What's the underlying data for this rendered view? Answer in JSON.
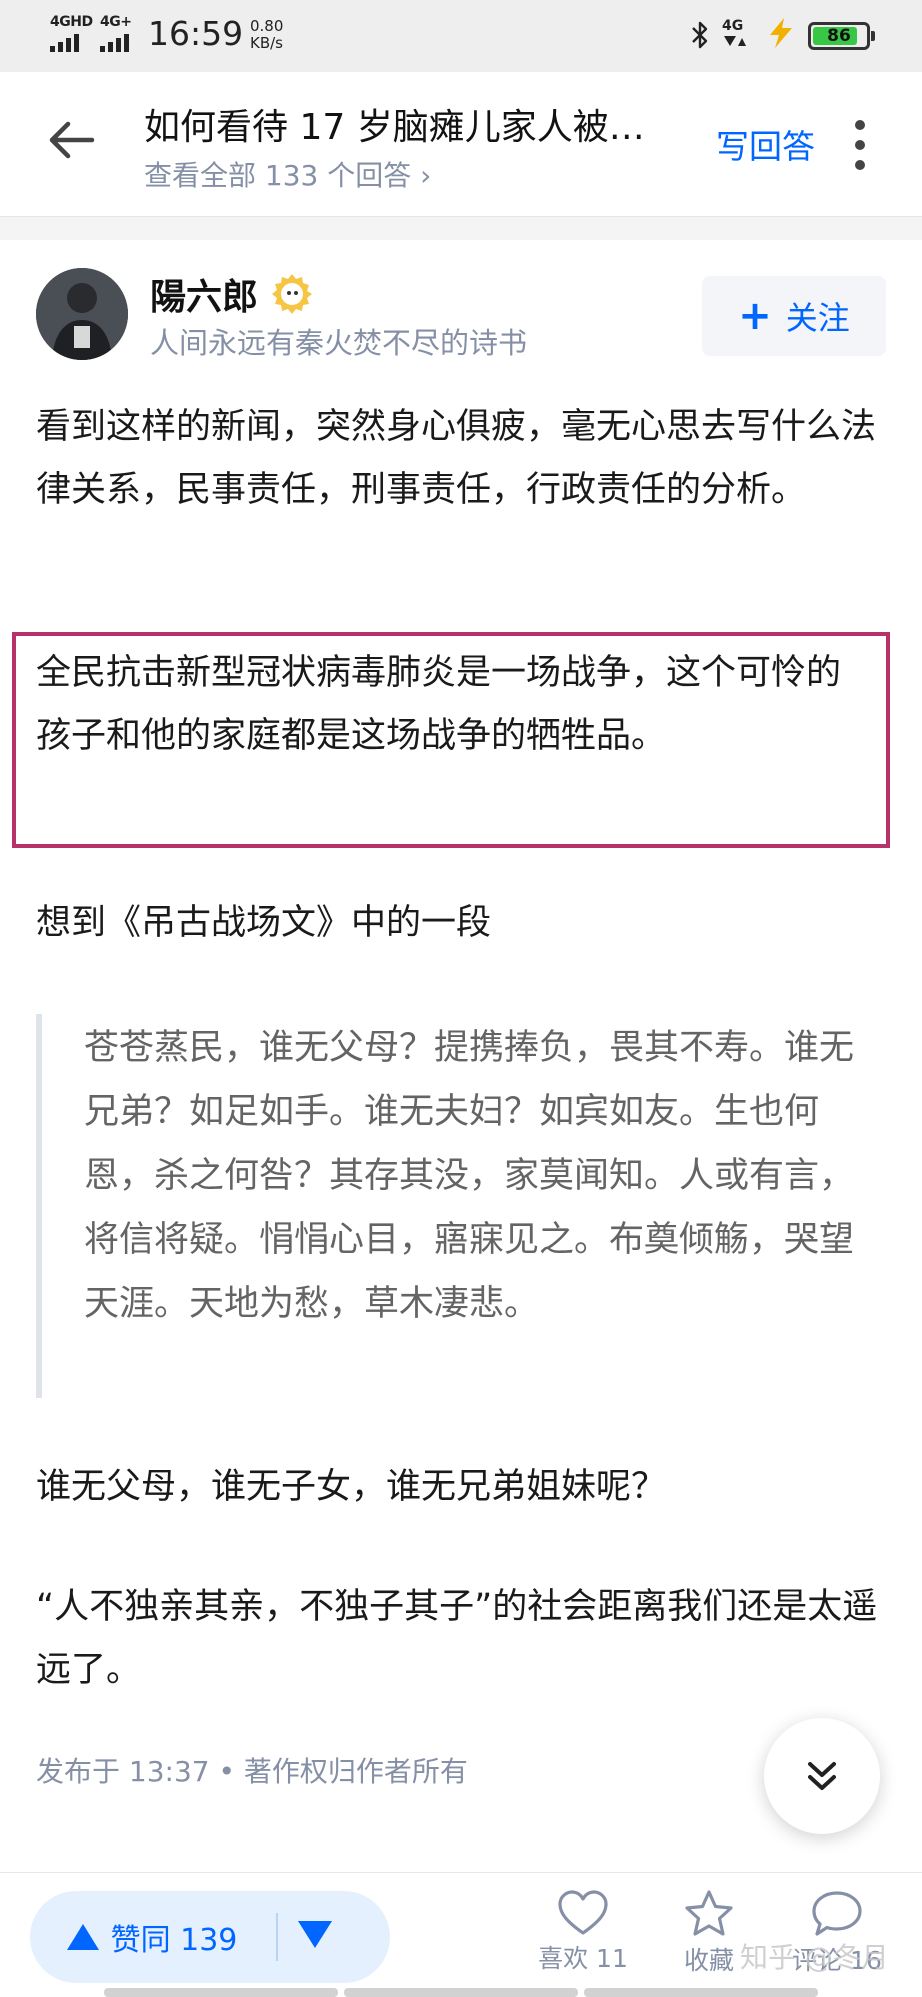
{
  "status_bar": {
    "signal1_label": "4GHD",
    "signal2_label": "4G+",
    "time": "16:59",
    "net_speed_value": "0.80",
    "net_speed_unit": "KB/s",
    "signal3_label": "4G",
    "battery_percent": "86",
    "battery_level": 0.86
  },
  "header": {
    "title": "如何看待 17 岁脑瘫儿家人被…",
    "subtitle": "查看全部 133 个回答 ›",
    "write_answer": "写回答"
  },
  "author": {
    "name": "陽六郎",
    "motto": "人间永远有秦火焚不尽的诗书",
    "follow_label": "关注"
  },
  "content": {
    "p1": "看到这样的新闻，突然身心俱疲，毫无心思去写什么法律关系，民事责任，刑事责任，行政责任的分析。",
    "p2": "全民抗击新型冠状病毒肺炎是一场战争，这个可怜的孩子和他的家庭都是这场战争的牺牲品。",
    "p3": "想到《吊古战场文》中的一段",
    "quote": "苍苍蒸民，谁无父母？提携捧负，畏其不寿。谁无兄弟？如足如手。谁无夫妇？如宾如友。生也何恩，杀之何咎？其存其没，家莫闻知。人或有言，将信将疑。悁悁心目，寤寐见之。布奠倾觞，哭望天涯。天地为愁，草木凄悲。",
    "p4": "谁无父母，谁无子女，谁无兄弟姐妹呢？",
    "p5": "“人不独亲其亲，不独子其子”的社会距离我们还是太遥远了。",
    "publish": "发布于 13:37 • 著作权归作者所有"
  },
  "bottom_bar": {
    "vote_up_label": "赞同 139",
    "like_label": "喜欢 11",
    "favorite_label": "收藏",
    "comment_label": "评论 16",
    "watermark": "知乎 @冬月"
  },
  "colors": {
    "accent": "#0066ff",
    "highlight_border": "#b8326a",
    "muted": "#8590a6"
  }
}
